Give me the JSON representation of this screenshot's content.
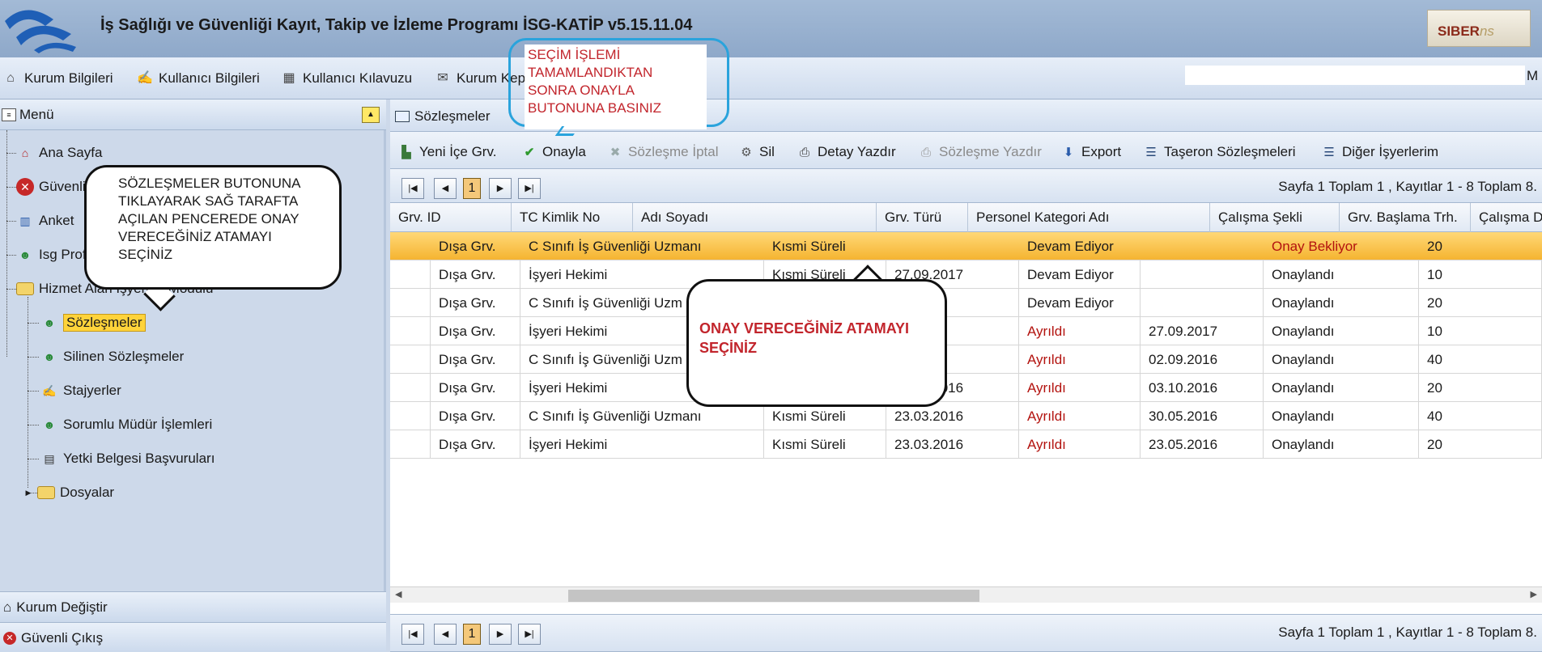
{
  "window": {
    "title": "İş Sağlığı ve Güvenliği Kayıt, Takip ve İzleme Programı İSG-KATİP v5.15.11.04",
    "brand_a": "SIBER",
    "brand_b": "ns"
  },
  "topmenu": {
    "kurum_bilgileri": "Kurum Bilgileri",
    "kullanici_bilgileri": "Kullanıcı Bilgileri",
    "kullanici_kilavuzu": "Kullanıcı Kılavuzu",
    "kurum_kep": "Kurum Kep",
    "user_tail": "M"
  },
  "sidebar": {
    "title": "Menü",
    "items": {
      "ana_sayfa": "Ana Sayfa",
      "guvenli_cikis": "Güvenli Çıkış",
      "anket": "Anket",
      "isg_profesyonel": "Isg Profesyo",
      "hizmet_alan": "Hizmet Alan İşyerleri Modülü",
      "sozlesmeler": "Sözleşmeler",
      "silinen_sozlesmeler": "Silinen Sözleşmeler",
      "stajyerler": "Stajyerler",
      "sorumlu_mudur": "Sorumlu Müdür İşlemleri",
      "yetki_belgesi": "Yetki Belgesi Başvuruları",
      "dosyalar": "Dosyalar"
    },
    "kurum_degistir": "Kurum Değiştir",
    "guvenli_cikis_bottom": "Güvenli Çıkış"
  },
  "main": {
    "tab": "Sözleşmeler",
    "toolbar": {
      "yeni_ice_grv": "Yeni İçe Grv.",
      "onayla": "Onayla",
      "sozlesme_iptal": "Sözleşme İptal",
      "sil": "Sil",
      "detay_yazdir": "Detay Yazdır",
      "sozlesme_yazdir": "Sözleşme Yazdır",
      "export": "Export",
      "taseron": "Taşeron Sözleşmeleri",
      "diger": "Diğer İşyerlerim"
    },
    "pager": {
      "page": "1",
      "info": "Sayfa 1 Toplam 1 , Kayıtlar 1 - 8 Toplam 8."
    },
    "columns": [
      "Grv. ID",
      "TC Kimlik No",
      "Adı Soyadı",
      "Grv. Türü",
      "Personel Kategori Adı",
      "Çalışma Şekli",
      "Grv. Başlama Trh.",
      "Çalışma Du"
    ],
    "rows": [
      [
        "",
        "Dışa Grv.",
        "C Sınıfı İş Güvenliği Uzmanı",
        "Kısmi Süreli",
        "",
        "Devam Ediyor",
        "",
        "Onay Bekliyor",
        "20"
      ],
      [
        "",
        "Dışa Grv.",
        "İşyeri Hekimi",
        "Kısmi Süreli",
        "27.09.2017",
        "Devam Ediyor",
        "",
        "Onaylandı",
        "10"
      ],
      [
        "",
        "Dışa Grv.",
        "C Sınıfı İş Güvenliği Uzm",
        "",
        "2017",
        "Devam Ediyor",
        "",
        "Onaylandı",
        "20"
      ],
      [
        "",
        "Dışa Grv.",
        "İşyeri Hekimi",
        "",
        "2017",
        "Ayrıldı",
        "27.09.2017",
        "Onaylandı",
        "10"
      ],
      [
        "",
        "Dışa Grv.",
        "C Sınıfı İş Güvenliği Uzm",
        "",
        "2016",
        "Ayrıldı",
        "02.09.2016",
        "Onaylandı",
        "40"
      ],
      [
        "",
        "Dışa Grv.",
        "İşyeri Hekimi",
        "Kısmi Süreli",
        "24.05.2016",
        "Ayrıldı",
        "03.10.2016",
        "Onaylandı",
        "20"
      ],
      [
        "",
        "Dışa Grv.",
        "C Sınıfı İş Güvenliği Uzmanı",
        "Kısmi Süreli",
        "23.03.2016",
        "Ayrıldı",
        "30.05.2016",
        "Onaylandı",
        "40"
      ],
      [
        "",
        "Dışa Grv.",
        "İşyeri Hekimi",
        "Kısmi Süreli",
        "23.03.2016",
        "Ayrıldı",
        "23.05.2016",
        "Onaylandı",
        "20"
      ]
    ]
  },
  "annotations": {
    "blue": [
      "SEÇİM İŞLEMİ",
      "TAMAMLANDIKTAN",
      "SONRA ONAYLA",
      "BUTONUNA BASINIZ"
    ],
    "left": [
      "SÖZLEŞMELER BUTONUNA",
      "TIKLAYARAK SAĞ TARAFTA",
      "AÇILAN PENCEREDE ONAY",
      "VERECEĞİNİZ ATAMAYI",
      "SEÇİNİZ"
    ],
    "mid": [
      "ONAY VERECEĞİNİZ ATAMAYI",
      "SEÇİNİZ"
    ]
  },
  "colors": {
    "selected_row": "#f5b431",
    "status_red": "#b3130f",
    "annotation_red": "#c2252c",
    "annotation_blue": "#2aa3dc"
  }
}
